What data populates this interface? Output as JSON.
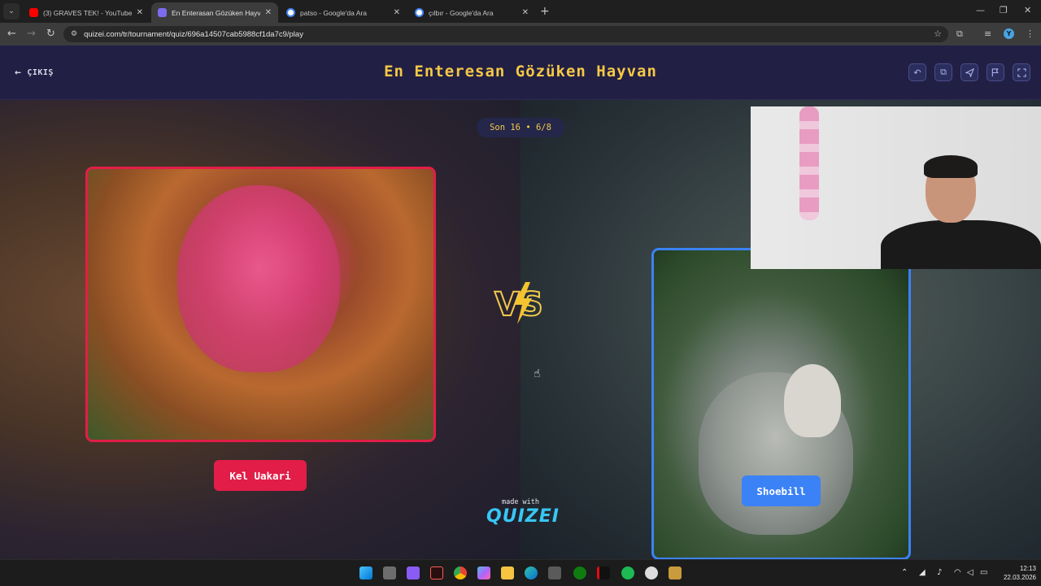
{
  "browser": {
    "tabs": [
      {
        "label": "(3) GRAVES TEK! - YouTube",
        "favicon_color": "#ff0000"
      },
      {
        "label": "En Enterasan Gözüken Hayvan",
        "favicon_color": "#7c6cf0"
      },
      {
        "label": "patso - Google'da Ara",
        "favicon_color": "#ffffff"
      },
      {
        "label": "çılbır - Google'da Ara",
        "favicon_color": "#ffffff"
      }
    ],
    "url": "quizei.com/tr/tournament/quiz/696a14507cab5988cf1da7c9/play",
    "profile_initial": "Y"
  },
  "header": {
    "exit_label": "ÇIKIŞ",
    "title": "En Enteresan Gözüken Hayvan",
    "actions": [
      "undo-icon",
      "copy-icon",
      "share-icon",
      "flag-icon",
      "fullscreen-icon"
    ]
  },
  "round": {
    "label": "Son 16 • 6/8"
  },
  "versus": {
    "left": {
      "name": "Kel Uakari",
      "color": "#e11d48"
    },
    "right": {
      "name": "Shoebill",
      "color": "#3b82f6"
    },
    "vs_text": "VS"
  },
  "footer": {
    "made_with": "made with",
    "brand": "QUIZEI"
  },
  "taskbar": {
    "time": "12:13",
    "date": "22.03.2026"
  }
}
